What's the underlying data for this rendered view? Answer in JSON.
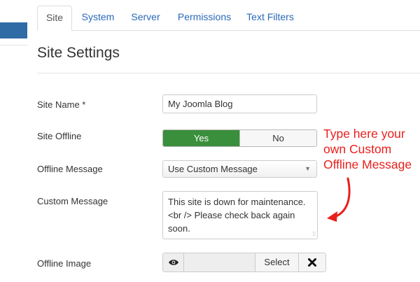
{
  "tabs": [
    {
      "label": "Site"
    },
    {
      "label": "System"
    },
    {
      "label": "Server"
    },
    {
      "label": "Permissions"
    },
    {
      "label": "Text Filters"
    }
  ],
  "active_tab": "Site",
  "section_title": "Site Settings",
  "fields": {
    "site_name": {
      "label": "Site Name *",
      "value": "My Joomla Blog"
    },
    "site_offline": {
      "label": "Site Offline",
      "yes_label": "Yes",
      "no_label": "No",
      "selected": "Yes"
    },
    "offline_message": {
      "label": "Offline Message",
      "selected": "Use Custom Message"
    },
    "custom_message": {
      "label": "Custom Message",
      "value": "This site is down for maintenance.<br /> Please check back again soon."
    },
    "offline_image": {
      "label": "Offline Image",
      "select_label": "Select"
    }
  },
  "annotation": {
    "text": "Type here your own Custom Offline Message",
    "color": "#e8201c"
  },
  "colors": {
    "link": "#2a69b8",
    "toggle_active": "#3a8f3c",
    "accent": "#2f6ca6"
  },
  "icons": {
    "preview": "eye-icon",
    "clear": "close-icon",
    "dropdown": "caret-down-icon"
  }
}
